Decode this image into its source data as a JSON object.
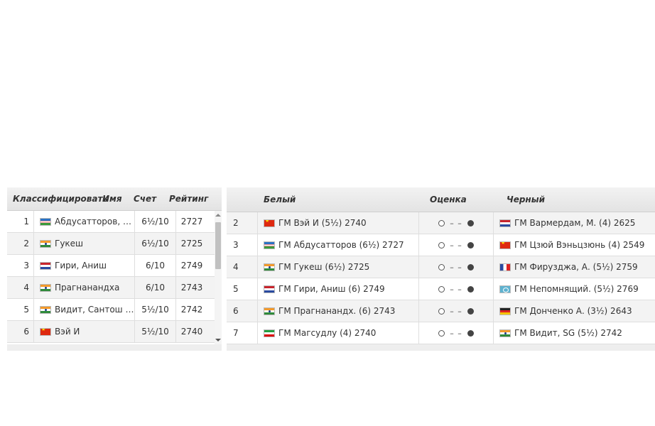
{
  "standings": {
    "headers": {
      "rank": "Классифицировать",
      "name": "Имя",
      "score": "Счет",
      "rating": "Рейтинг"
    },
    "rows": [
      {
        "rank": "1",
        "flag": "flag-uz",
        "name": "Абдусатторов, …",
        "score": "6½/10",
        "rating": "2727"
      },
      {
        "rank": "2",
        "flag": "flag-in",
        "name": "Гукеш",
        "score": "6½/10",
        "rating": "2725"
      },
      {
        "rank": "3",
        "flag": "flag-nl",
        "name": "Гири, Аниш",
        "score": "6/10",
        "rating": "2749"
      },
      {
        "rank": "4",
        "flag": "flag-in",
        "name": "Прагнанандха",
        "score": "6/10",
        "rating": "2743"
      },
      {
        "rank": "5",
        "flag": "flag-in",
        "name": "Видит, Сантош …",
        "score": "5½/10",
        "rating": "2742"
      },
      {
        "rank": "6",
        "flag": "flag-cn",
        "name": "Вэй И",
        "score": "5½/10",
        "rating": "2740"
      }
    ]
  },
  "pairings": {
    "headers": {
      "white": "Белый",
      "eval": "Оценка",
      "black": "Черный"
    },
    "rows": [
      {
        "board": "2",
        "white_flag": "flag-cn",
        "white": "ГМ Вэй И (5½) 2740",
        "black_flag": "flag-nl",
        "black": "ГМ Вармердам, М. (4) 2625"
      },
      {
        "board": "3",
        "white_flag": "flag-uz",
        "white": "ГМ Абдусатторов (6½) 2727",
        "black_flag": "flag-cn",
        "black": "ГМ Цзюй Вэньцзюнь (4) 2549"
      },
      {
        "board": "4",
        "white_flag": "flag-in",
        "white": "ГМ Гукеш (6½) 2725",
        "black_flag": "flag-fr",
        "black": "ГМ Фирузджа, А. (5½) 2759"
      },
      {
        "board": "5",
        "white_flag": "flag-nl",
        "white": "ГМ Гири, Аниш (6) 2749",
        "black_flag": "flag-fide",
        "black": "ГМ Непомнящий. (5½) 2769"
      },
      {
        "board": "6",
        "white_flag": "flag-in",
        "white": "ГМ Прагнанандх. (6) 2743",
        "black_flag": "flag-de",
        "black": "ГМ Донченко А. (3½) 2643"
      },
      {
        "board": "7",
        "white_flag": "flag-ir",
        "white": "ГМ Магсудлу (4) 2740",
        "black_flag": "flag-in",
        "black": "ГМ Видит, SG (5½) 2742"
      }
    ],
    "eval_dashes": "– –"
  }
}
